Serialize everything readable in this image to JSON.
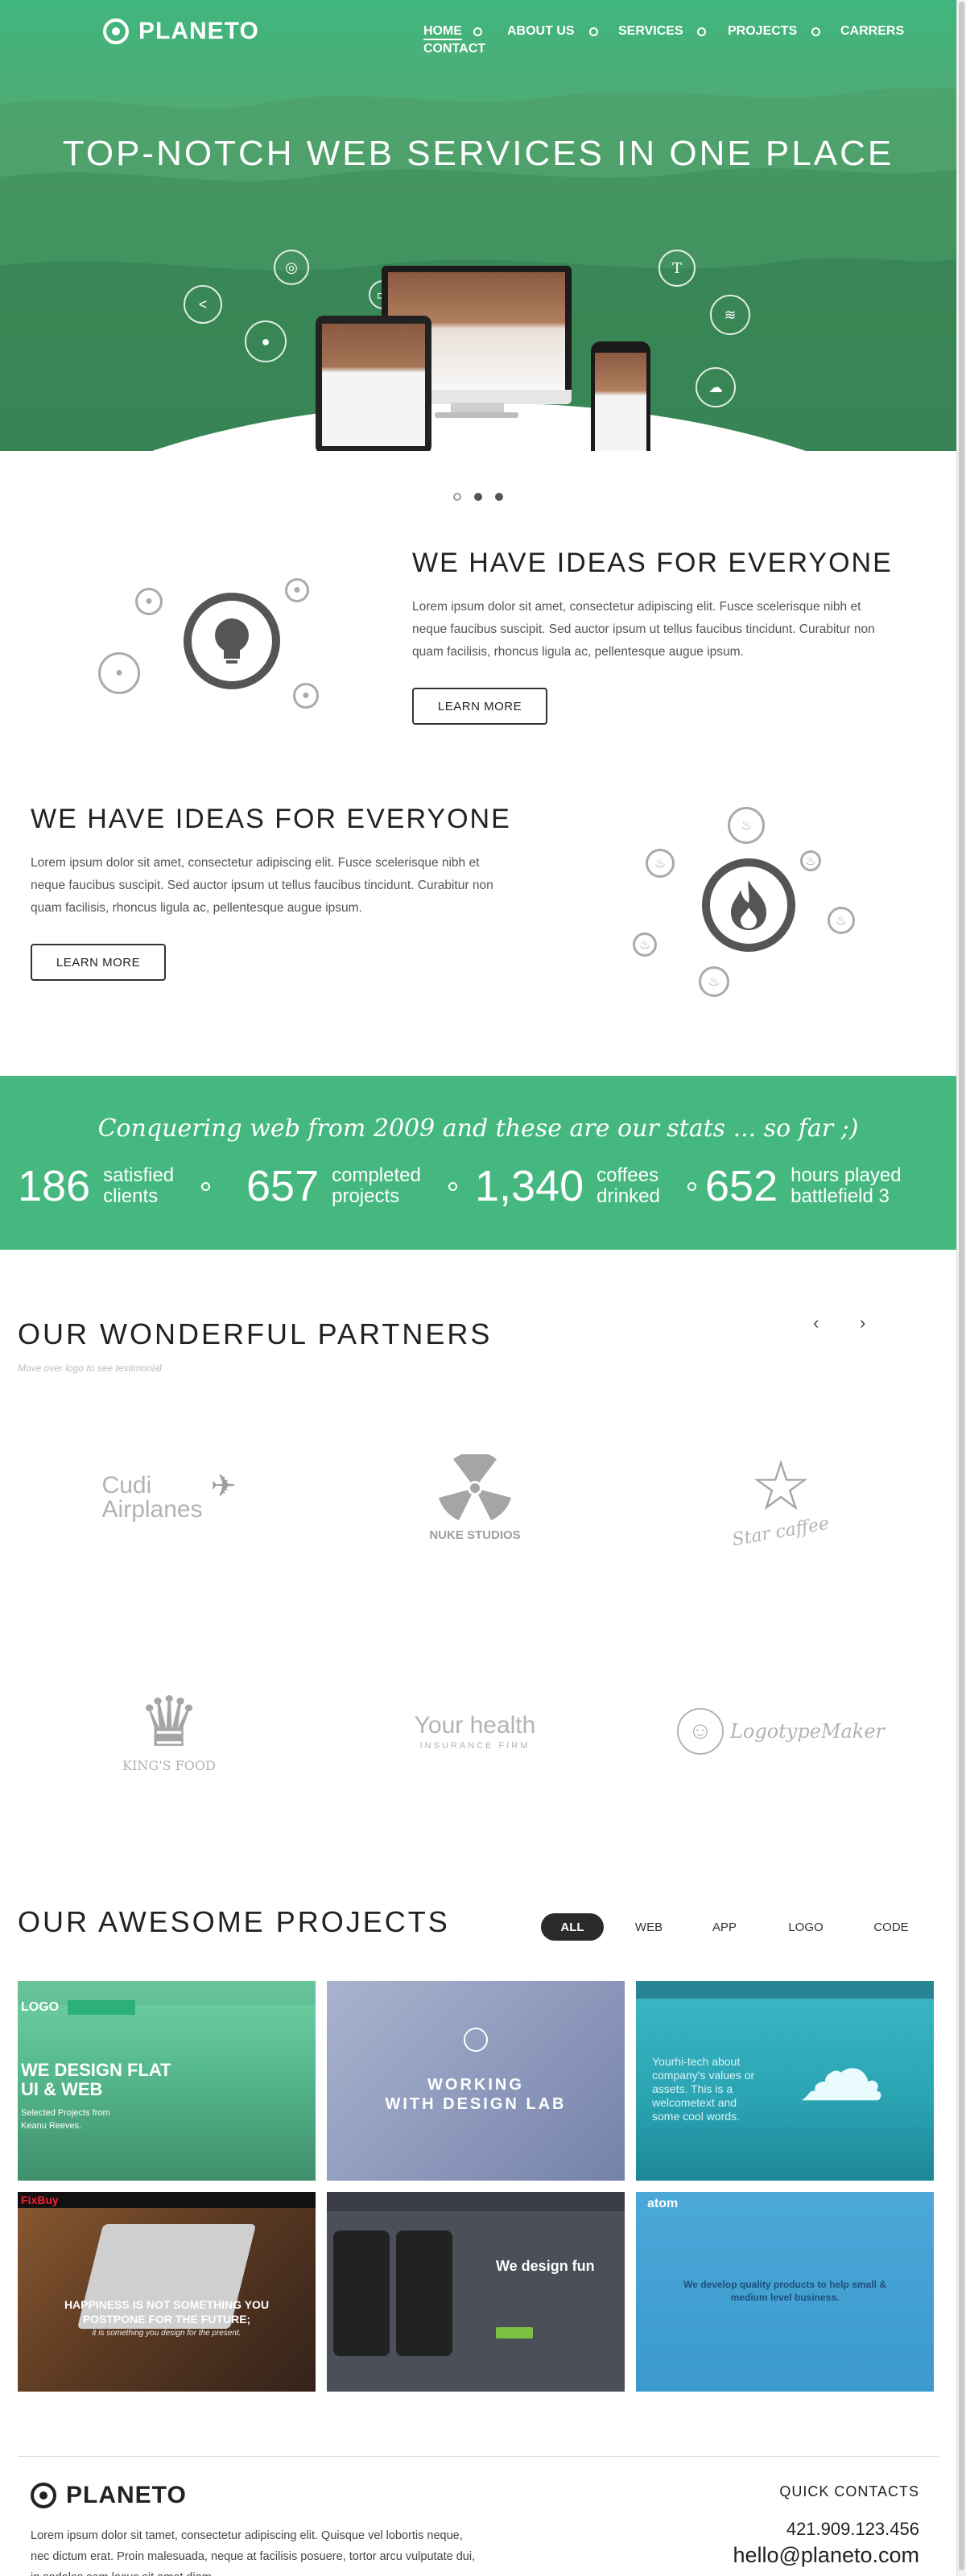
{
  "brand": {
    "name": "PLANETO"
  },
  "nav": {
    "items": [
      "HOME",
      "ABOUT US",
      "SERVICES",
      "PROJECTS",
      "CARRERS",
      "CONTACT"
    ]
  },
  "hero": {
    "title": "TOP-NOTCH WEB SERVICES IN ONE PLACE"
  },
  "ideas": [
    {
      "title": "WE HAVE IDEAS FOR EVERYONE",
      "text": "Lorem ipsum dolor sit amet, consectetur adipiscing elit. Fusce scelerisque nibh et neque faucibus suscipit. Sed auctor ipsum ut tellus faucibus tincidunt. Curabitur non quam facilisis, rhoncus ligula ac, pellentesque augue ipsum.",
      "button": "LEARN MORE"
    },
    {
      "title": "WE HAVE IDEAS FOR EVERYONE",
      "text": "Lorem ipsum dolor sit amet, consectetur adipiscing elit. Fusce scelerisque nibh et neque faucibus suscipit. Sed auctor ipsum ut tellus faucibus tincidunt. Curabitur non quam facilisis, rhoncus ligula ac, pellentesque augue ipsum.",
      "button": "LEARN MORE"
    }
  ],
  "stats": {
    "tagline": "Conquering web from 2009 and these are our stats ... so far ;)",
    "items": [
      {
        "num": "186",
        "l1": "satisfied",
        "l2": "clients"
      },
      {
        "num": "657",
        "l1": "completed",
        "l2": "projects"
      },
      {
        "num": "1,340",
        "l1": "coffees",
        "l2": "drinked"
      },
      {
        "num": "652",
        "l1": "hours played",
        "l2": "battlefield 3"
      }
    ]
  },
  "partners": {
    "title": "OUR WONDERFUL PARTNERS",
    "hint": "Move over logo to see testimonial",
    "logos": [
      {
        "l1": "Cudi",
        "l2": "Airplanes"
      },
      {
        "l1": "NUKE STUDIOS"
      },
      {
        "l1": "Star caffee"
      },
      {
        "l1": "KING'S FOOD"
      },
      {
        "l1": "Your health",
        "l2": "INSURANCE FIRM"
      },
      {
        "l1": "LogotypeMaker"
      }
    ]
  },
  "projects": {
    "title": "OUR AWESOME PROJECTS",
    "filters": [
      "ALL",
      "WEB",
      "APP",
      "LOGO",
      "CODE"
    ],
    "items": [
      {
        "l1": "WE DESIGN FLAT",
        "l2": "UI & WEB",
        "l3": "Selected Projects from",
        "l4": "Keanu Reeves."
      },
      {
        "l1": "WORKING",
        "l2": "WITH DESIGN LAB"
      },
      {
        "l1": "Yourhi-tech about",
        "l2": "company's values or",
        "l3": "assets. This is a",
        "l4": "welcometext and",
        "l5": "some cool words."
      },
      {
        "l1": "HAPPINESS IS NOT SOMETHING YOU",
        "l2": "POSTPONE FOR THE FUTURE;",
        "l3": "it is something you design for the present."
      },
      {
        "l1": "We design fun"
      },
      {
        "l1": "We develop quality products to help small &",
        "l2": "medium level business."
      }
    ]
  },
  "footer": {
    "text": "Lorem ipsum dolor sit tamet, consectetur adipiscing elit. Quisque vel lobortis neque, nec dictum erat. Proin malesuada, neque at facilisis posuere, tortor arcu vulputate dui, in sodales sem lacus sit amet diam.",
    "contacts_title": "QUICK CONTACTS",
    "phone": "421.909.123.456",
    "email": "hello@planeto.com"
  },
  "colors": {
    "brand_green": "#45b880",
    "dark": "#2b2b2b",
    "gray_icon": "#555555"
  }
}
